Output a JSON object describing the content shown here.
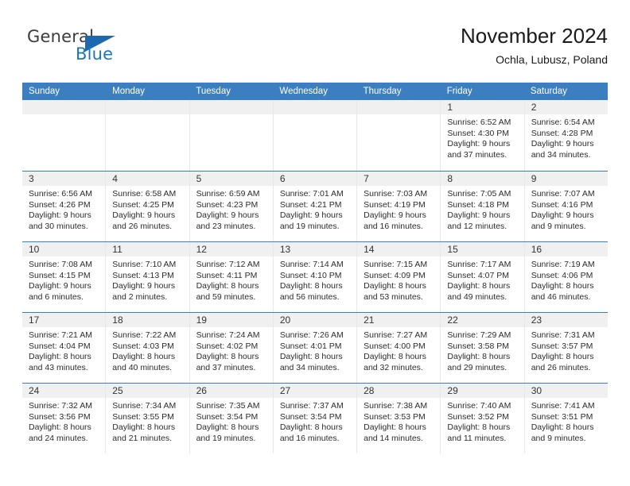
{
  "brand": {
    "name_part1": "General",
    "name_part2": "Blue",
    "flag_icon": "triangle-flag-icon"
  },
  "header": {
    "month_title": "November 2024",
    "location": "Ochla, Lubusz, Poland"
  },
  "theme": {
    "header_blue": "#3c7fc1",
    "brand_blue": "#1b76bc",
    "day_band_gray": "#f0f0f0",
    "cell_border": "#e8e8e8"
  },
  "calendar": {
    "weekdays": [
      "Sunday",
      "Monday",
      "Tuesday",
      "Wednesday",
      "Thursday",
      "Friday",
      "Saturday"
    ],
    "weeks": [
      [
        {
          "day": "",
          "sunrise": "",
          "sunset": "",
          "daylight_line1": "",
          "daylight_line2": "",
          "empty": true
        },
        {
          "day": "",
          "sunrise": "",
          "sunset": "",
          "daylight_line1": "",
          "daylight_line2": "",
          "empty": true
        },
        {
          "day": "",
          "sunrise": "",
          "sunset": "",
          "daylight_line1": "",
          "daylight_line2": "",
          "empty": true
        },
        {
          "day": "",
          "sunrise": "",
          "sunset": "",
          "daylight_line1": "",
          "daylight_line2": "",
          "empty": true
        },
        {
          "day": "",
          "sunrise": "",
          "sunset": "",
          "daylight_line1": "",
          "daylight_line2": "",
          "empty": true
        },
        {
          "day": "1",
          "sunrise": "Sunrise: 6:52 AM",
          "sunset": "Sunset: 4:30 PM",
          "daylight_line1": "Daylight: 9 hours",
          "daylight_line2": "and 37 minutes.",
          "empty": false
        },
        {
          "day": "2",
          "sunrise": "Sunrise: 6:54 AM",
          "sunset": "Sunset: 4:28 PM",
          "daylight_line1": "Daylight: 9 hours",
          "daylight_line2": "and 34 minutes.",
          "empty": false
        }
      ],
      [
        {
          "day": "3",
          "sunrise": "Sunrise: 6:56 AM",
          "sunset": "Sunset: 4:26 PM",
          "daylight_line1": "Daylight: 9 hours",
          "daylight_line2": "and 30 minutes.",
          "empty": false
        },
        {
          "day": "4",
          "sunrise": "Sunrise: 6:58 AM",
          "sunset": "Sunset: 4:25 PM",
          "daylight_line1": "Daylight: 9 hours",
          "daylight_line2": "and 26 minutes.",
          "empty": false
        },
        {
          "day": "5",
          "sunrise": "Sunrise: 6:59 AM",
          "sunset": "Sunset: 4:23 PM",
          "daylight_line1": "Daylight: 9 hours",
          "daylight_line2": "and 23 minutes.",
          "empty": false
        },
        {
          "day": "6",
          "sunrise": "Sunrise: 7:01 AM",
          "sunset": "Sunset: 4:21 PM",
          "daylight_line1": "Daylight: 9 hours",
          "daylight_line2": "and 19 minutes.",
          "empty": false
        },
        {
          "day": "7",
          "sunrise": "Sunrise: 7:03 AM",
          "sunset": "Sunset: 4:19 PM",
          "daylight_line1": "Daylight: 9 hours",
          "daylight_line2": "and 16 minutes.",
          "empty": false
        },
        {
          "day": "8",
          "sunrise": "Sunrise: 7:05 AM",
          "sunset": "Sunset: 4:18 PM",
          "daylight_line1": "Daylight: 9 hours",
          "daylight_line2": "and 12 minutes.",
          "empty": false
        },
        {
          "day": "9",
          "sunrise": "Sunrise: 7:07 AM",
          "sunset": "Sunset: 4:16 PM",
          "daylight_line1": "Daylight: 9 hours",
          "daylight_line2": "and 9 minutes.",
          "empty": false
        }
      ],
      [
        {
          "day": "10",
          "sunrise": "Sunrise: 7:08 AM",
          "sunset": "Sunset: 4:15 PM",
          "daylight_line1": "Daylight: 9 hours",
          "daylight_line2": "and 6 minutes.",
          "empty": false
        },
        {
          "day": "11",
          "sunrise": "Sunrise: 7:10 AM",
          "sunset": "Sunset: 4:13 PM",
          "daylight_line1": "Daylight: 9 hours",
          "daylight_line2": "and 2 minutes.",
          "empty": false
        },
        {
          "day": "12",
          "sunrise": "Sunrise: 7:12 AM",
          "sunset": "Sunset: 4:11 PM",
          "daylight_line1": "Daylight: 8 hours",
          "daylight_line2": "and 59 minutes.",
          "empty": false
        },
        {
          "day": "13",
          "sunrise": "Sunrise: 7:14 AM",
          "sunset": "Sunset: 4:10 PM",
          "daylight_line1": "Daylight: 8 hours",
          "daylight_line2": "and 56 minutes.",
          "empty": false
        },
        {
          "day": "14",
          "sunrise": "Sunrise: 7:15 AM",
          "sunset": "Sunset: 4:09 PM",
          "daylight_line1": "Daylight: 8 hours",
          "daylight_line2": "and 53 minutes.",
          "empty": false
        },
        {
          "day": "15",
          "sunrise": "Sunrise: 7:17 AM",
          "sunset": "Sunset: 4:07 PM",
          "daylight_line1": "Daylight: 8 hours",
          "daylight_line2": "and 49 minutes.",
          "empty": false
        },
        {
          "day": "16",
          "sunrise": "Sunrise: 7:19 AM",
          "sunset": "Sunset: 4:06 PM",
          "daylight_line1": "Daylight: 8 hours",
          "daylight_line2": "and 46 minutes.",
          "empty": false
        }
      ],
      [
        {
          "day": "17",
          "sunrise": "Sunrise: 7:21 AM",
          "sunset": "Sunset: 4:04 PM",
          "daylight_line1": "Daylight: 8 hours",
          "daylight_line2": "and 43 minutes.",
          "empty": false
        },
        {
          "day": "18",
          "sunrise": "Sunrise: 7:22 AM",
          "sunset": "Sunset: 4:03 PM",
          "daylight_line1": "Daylight: 8 hours",
          "daylight_line2": "and 40 minutes.",
          "empty": false
        },
        {
          "day": "19",
          "sunrise": "Sunrise: 7:24 AM",
          "sunset": "Sunset: 4:02 PM",
          "daylight_line1": "Daylight: 8 hours",
          "daylight_line2": "and 37 minutes.",
          "empty": false
        },
        {
          "day": "20",
          "sunrise": "Sunrise: 7:26 AM",
          "sunset": "Sunset: 4:01 PM",
          "daylight_line1": "Daylight: 8 hours",
          "daylight_line2": "and 34 minutes.",
          "empty": false
        },
        {
          "day": "21",
          "sunrise": "Sunrise: 7:27 AM",
          "sunset": "Sunset: 4:00 PM",
          "daylight_line1": "Daylight: 8 hours",
          "daylight_line2": "and 32 minutes.",
          "empty": false
        },
        {
          "day": "22",
          "sunrise": "Sunrise: 7:29 AM",
          "sunset": "Sunset: 3:58 PM",
          "daylight_line1": "Daylight: 8 hours",
          "daylight_line2": "and 29 minutes.",
          "empty": false
        },
        {
          "day": "23",
          "sunrise": "Sunrise: 7:31 AM",
          "sunset": "Sunset: 3:57 PM",
          "daylight_line1": "Daylight: 8 hours",
          "daylight_line2": "and 26 minutes.",
          "empty": false
        }
      ],
      [
        {
          "day": "24",
          "sunrise": "Sunrise: 7:32 AM",
          "sunset": "Sunset: 3:56 PM",
          "daylight_line1": "Daylight: 8 hours",
          "daylight_line2": "and 24 minutes.",
          "empty": false
        },
        {
          "day": "25",
          "sunrise": "Sunrise: 7:34 AM",
          "sunset": "Sunset: 3:55 PM",
          "daylight_line1": "Daylight: 8 hours",
          "daylight_line2": "and 21 minutes.",
          "empty": false
        },
        {
          "day": "26",
          "sunrise": "Sunrise: 7:35 AM",
          "sunset": "Sunset: 3:54 PM",
          "daylight_line1": "Daylight: 8 hours",
          "daylight_line2": "and 19 minutes.",
          "empty": false
        },
        {
          "day": "27",
          "sunrise": "Sunrise: 7:37 AM",
          "sunset": "Sunset: 3:54 PM",
          "daylight_line1": "Daylight: 8 hours",
          "daylight_line2": "and 16 minutes.",
          "empty": false
        },
        {
          "day": "28",
          "sunrise": "Sunrise: 7:38 AM",
          "sunset": "Sunset: 3:53 PM",
          "daylight_line1": "Daylight: 8 hours",
          "daylight_line2": "and 14 minutes.",
          "empty": false
        },
        {
          "day": "29",
          "sunrise": "Sunrise: 7:40 AM",
          "sunset": "Sunset: 3:52 PM",
          "daylight_line1": "Daylight: 8 hours",
          "daylight_line2": "and 11 minutes.",
          "empty": false
        },
        {
          "day": "30",
          "sunrise": "Sunrise: 7:41 AM",
          "sunset": "Sunset: 3:51 PM",
          "daylight_line1": "Daylight: 8 hours",
          "daylight_line2": "and 9 minutes.",
          "empty": false
        }
      ]
    ]
  }
}
